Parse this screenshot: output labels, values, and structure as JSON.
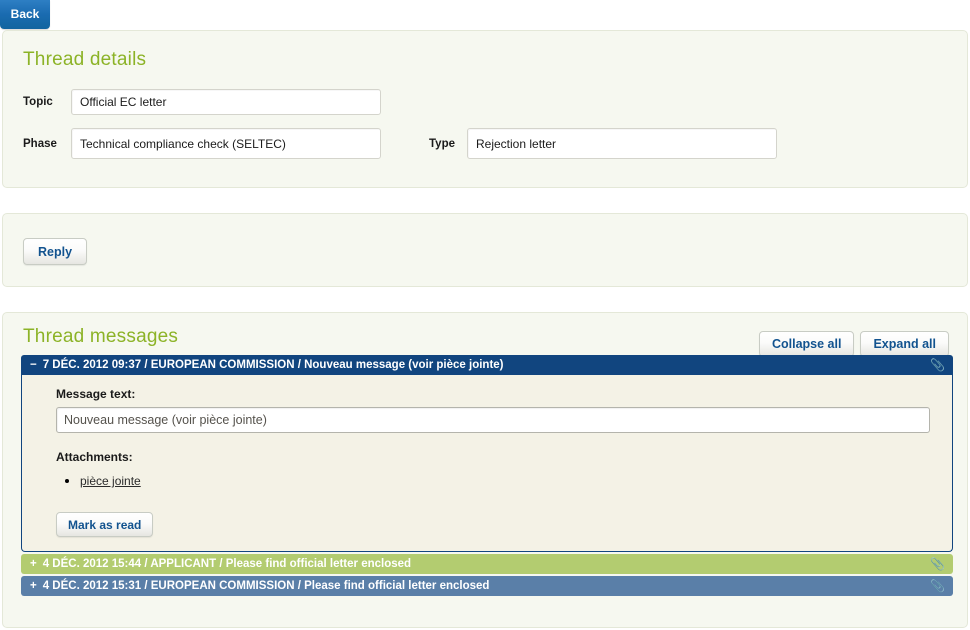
{
  "nav": {
    "back_label": "Back"
  },
  "details": {
    "title": "Thread details",
    "topic_label": "Topic",
    "topic_value": "Official EC letter",
    "phase_label": "Phase",
    "phase_value": "Technical compliance check (SELTEC)",
    "type_label": "Type",
    "type_value": "Rejection letter"
  },
  "reply": {
    "label": "Reply"
  },
  "messages": {
    "title": "Thread messages",
    "collapse_all_label": "Collapse all",
    "expand_all_label": "Expand all",
    "attachment_icon": "paperclip-icon",
    "items": [
      {
        "toggle": "−",
        "expanded": true,
        "sender": "EUROPEAN COMMISSION",
        "date": "7 DÉC. 2012 09:37",
        "subject": "Nouveau message (voir pièce jointe)",
        "header_text": "7 DÉC. 2012 09:37 / EUROPEAN COMMISSION / Nouveau message (voir pièce jointe)",
        "has_attachment": true,
        "message_text_label": "Message text:",
        "message_text_value": "Nouveau message (voir pièce jointe)",
        "attachments_label": "Attachments:",
        "attachments": [
          "pièce jointe"
        ],
        "mark_as_read_label": "Mark as read"
      },
      {
        "toggle": "+",
        "expanded": false,
        "sender": "APPLICANT",
        "date": "4 DÉC. 2012 15:44",
        "subject": "Please find official letter enclosed",
        "header_text": "4 DÉC. 2012 15:44 / APPLICANT / Please find official letter enclosed",
        "has_attachment": true
      },
      {
        "toggle": "+",
        "expanded": false,
        "sender": "EUROPEAN COMMISSION",
        "date": "4 DÉC. 2012 15:31",
        "subject": "Please find official letter enclosed",
        "header_text": "4 DÉC. 2012 15:31 / EUROPEAN COMMISSION / Please find official letter enclosed",
        "has_attachment": true
      }
    ]
  },
  "colors": {
    "panel_bg": "#f6f8f0",
    "heading_green": "#8cb327",
    "commission_blue": "#11457f",
    "applicant_green": "#b3cc70",
    "commission_collapsed": "#5a7fa8",
    "link_blue": "#12538f",
    "message_body_bg": "#f4f2e6"
  }
}
